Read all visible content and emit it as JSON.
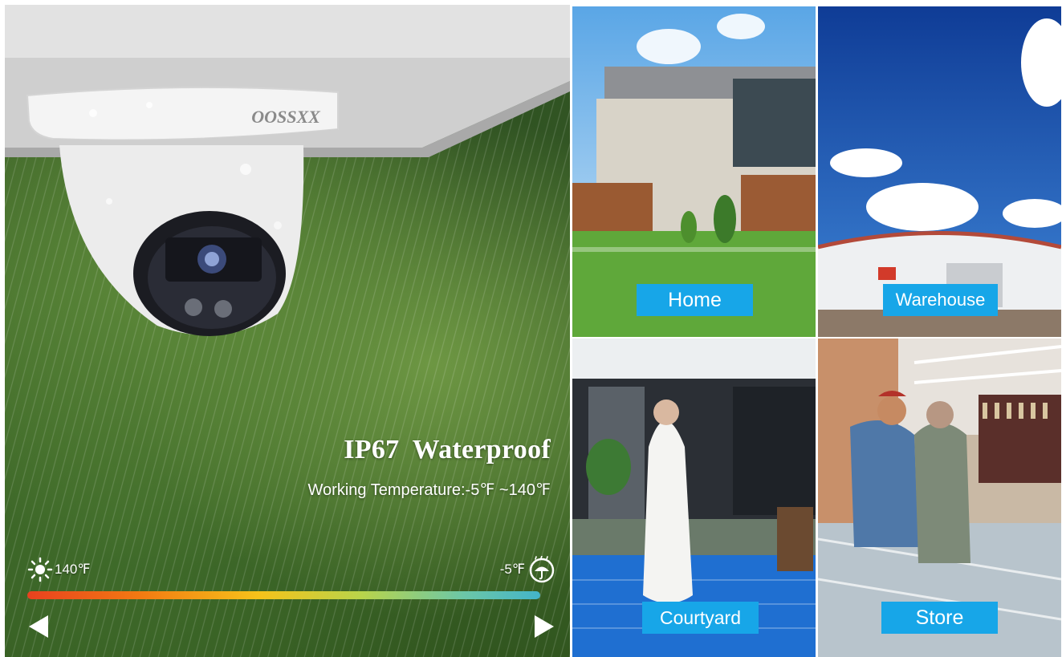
{
  "hero": {
    "brand": "OOSSXX",
    "headline": "IP67  Waterproof",
    "subline": "Working Temperature:-5℉ ~140℉",
    "temp_high": "140℉",
    "temp_low": "-5℉",
    "icons": {
      "high": "sun-icon",
      "low": "umbrella-rain-icon",
      "prev": "arrow-left-icon",
      "next": "arrow-right-icon"
    }
  },
  "scenarios": [
    {
      "label": "Home"
    },
    {
      "label": "Warehouse"
    },
    {
      "label": "Courtyard"
    },
    {
      "label": "Store"
    }
  ],
  "colors": {
    "label_bg": "#17a6e8",
    "bar_hot": "#e8411f",
    "bar_mid": "#f6c21a",
    "bar_cold": "#43b4c9"
  }
}
